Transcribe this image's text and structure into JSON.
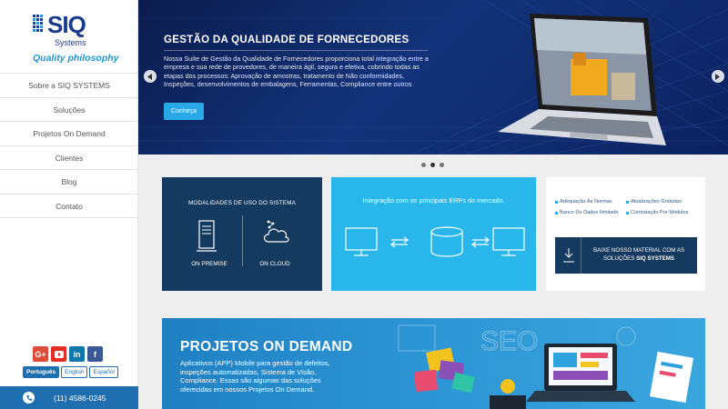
{
  "brand": {
    "name": "SIQ",
    "sub": "Systems",
    "tagline": "Quality philosophy"
  },
  "nav": [
    {
      "label": "Sobre a SIQ SYSTEMS"
    },
    {
      "label": "Soluções"
    },
    {
      "label": "Projetos On Demand"
    },
    {
      "label": "Clientes"
    },
    {
      "label": "Blog"
    },
    {
      "label": "Contato"
    }
  ],
  "social": [
    {
      "icon": "google-plus-icon",
      "glyph": "G+",
      "color": "#dd4b39"
    },
    {
      "icon": "youtube-icon",
      "glyph": "▶",
      "color": "#e52d27"
    },
    {
      "icon": "linkedin-icon",
      "glyph": "in",
      "color": "#0e76a8"
    },
    {
      "icon": "facebook-icon",
      "glyph": "f",
      "color": "#3b5998"
    }
  ],
  "languages": [
    {
      "label": "Português",
      "active": true
    },
    {
      "label": "English",
      "active": false
    },
    {
      "label": "Español",
      "active": false
    }
  ],
  "phone": "(11) 4586-0245",
  "hero": {
    "title": "GESTÃO DA QUALIDADE DE FORNECEDORES",
    "description": "Nossa Suíte de Gestão da Qualidade de Fornecedores proporciona total integração entre a empresa e sua rede de provedores, de maneira ágil, segura e efetiva, cobrindo todas as etapas dos processos: Aprovação de amostras, tratamento de Não conformidades, Inspeções, desenvolvimentos de embalagens, Ferramentas, Compliance entre outros",
    "button": "Conheça",
    "slides": 3,
    "active_slide": 2
  },
  "card_modalidades": {
    "title": "MODALIDADES DE USO DO SISTEMA",
    "option1": "ON PREMISE",
    "option2": "ON CLOUD"
  },
  "card_integracao": {
    "title": "Integração com os principais ERPs do mercado."
  },
  "card_material": {
    "features": [
      "Adequação Às Normas",
      "Atualizações Gratuitas",
      "Banco De Dados Ilimitado",
      "Contratação Por Módulos"
    ],
    "download_text": "BAIXE NOSSO MATERIAL COM AS SOLUÇÕES",
    "download_brand": "SIQ SYSTEMS"
  },
  "projetos": {
    "title": "PROJETOS ON DEMAND",
    "description": "Aplicativos (APP) Mobile para gestão de defeitos, inspeções automatizadas, Sistema de Visão, Compliance. Essas são algumas das soluções oferecidas em nossos Projetos On Demand."
  },
  "colors": {
    "primary": "#1f6fb0",
    "dark_navy": "#153a5f",
    "accent_cyan": "#29b6ea",
    "hero_bg": "#13337a"
  }
}
